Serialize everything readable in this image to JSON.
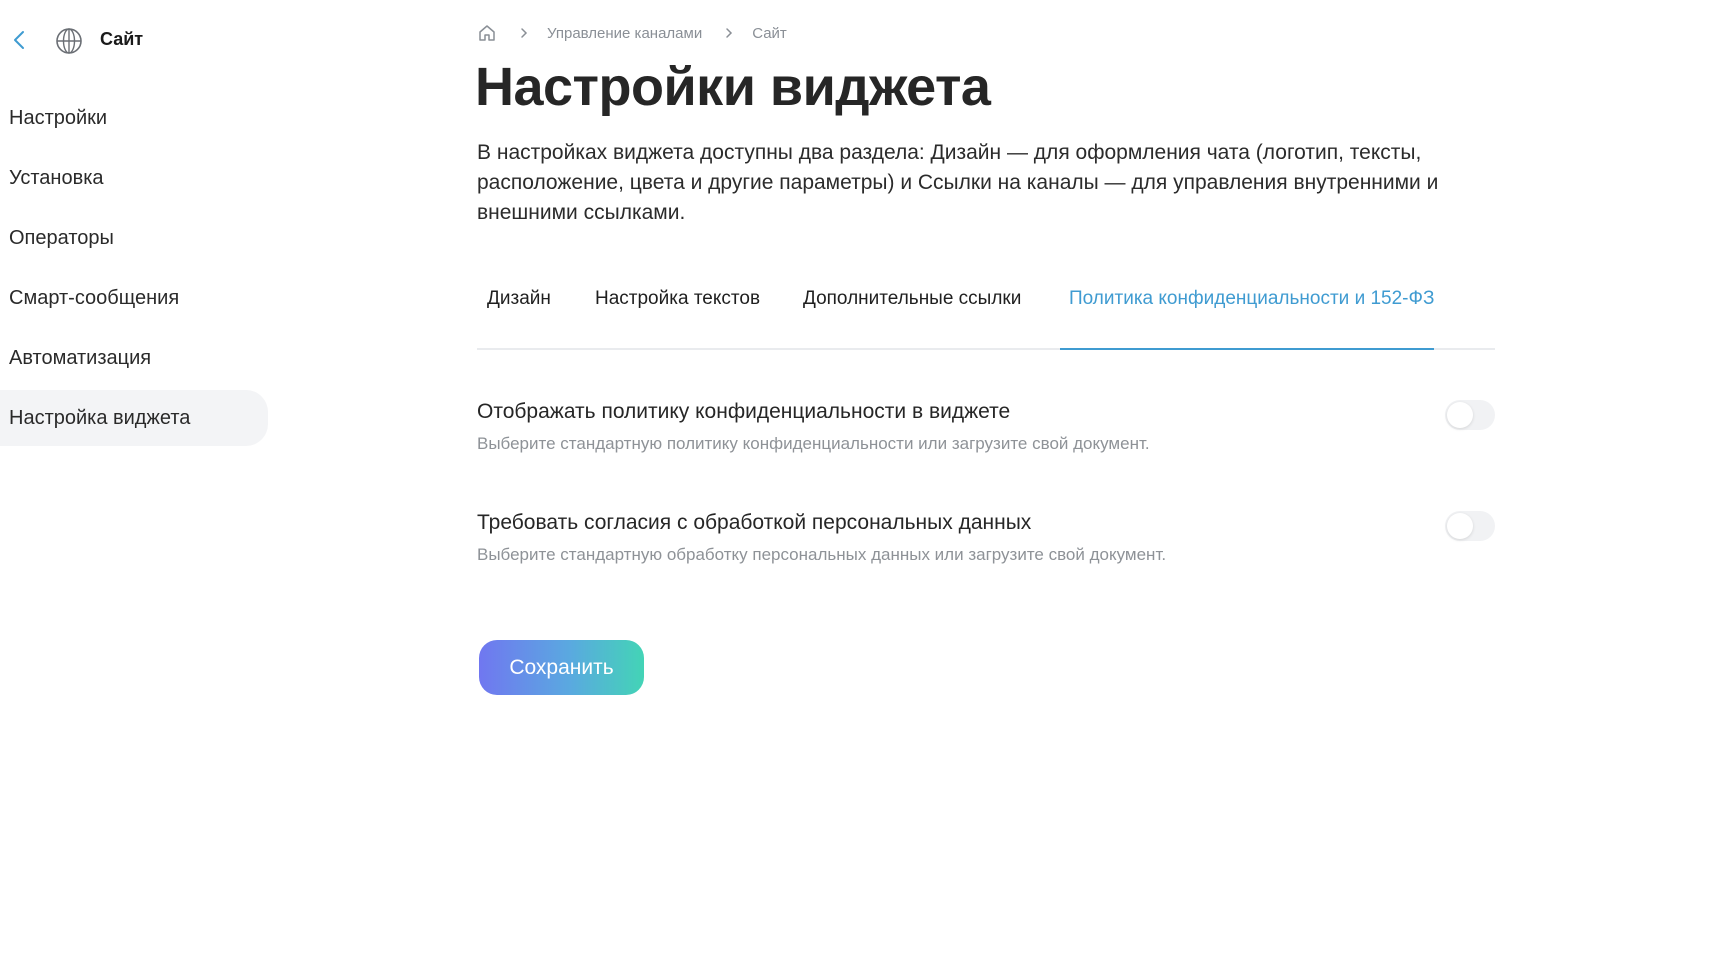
{
  "sidebar": {
    "title": "Сайт",
    "back_icon": "chevron-left-icon",
    "site_icon": "globe-icon",
    "items": [
      {
        "label": "Настройки",
        "active": false
      },
      {
        "label": "Установка",
        "active": false
      },
      {
        "label": "Операторы",
        "active": false
      },
      {
        "label": "Смарт-сообщения",
        "active": false
      },
      {
        "label": "Автоматизация",
        "active": false
      },
      {
        "label": "Настройка виджета",
        "active": true
      }
    ]
  },
  "breadcrumb": {
    "home_icon": "home-icon",
    "items": [
      "Управление каналами",
      "Сайт"
    ]
  },
  "page": {
    "title": "Настройки виджета",
    "description": "В настройках виджета доступны два раздела: Дизайн — для оформления чата (логотип, тексты, расположение, цвета и другие параметры) и Ссылки на каналы — для управления внутренними и внешними ссылками."
  },
  "tabs": [
    {
      "label": "Дизайн",
      "active": false
    },
    {
      "label": "Настройка текстов",
      "active": false
    },
    {
      "label": "Дополнительные ссылки",
      "active": false
    },
    {
      "label": "Политика конфиденциальности и 152-ФЗ",
      "active": true
    }
  ],
  "settings": [
    {
      "title": "Отображать политику конфиденциальности в виджете",
      "description": "Выберите стандартную политику конфиденциальности или загрузите свой документ.",
      "enabled": false
    },
    {
      "title": "Требовать согласия с обработкой персональных данных",
      "description": "Выберите стандартную обработку персональных данных или загрузите свой документ.",
      "enabled": false
    }
  ],
  "actions": {
    "save_label": "Сохранить"
  },
  "colors": {
    "accent": "#3f9bd1",
    "button_gradient_start": "#7077f0",
    "button_gradient_end": "#43d4b6",
    "active_nav_bg": "#f3f4f6"
  }
}
